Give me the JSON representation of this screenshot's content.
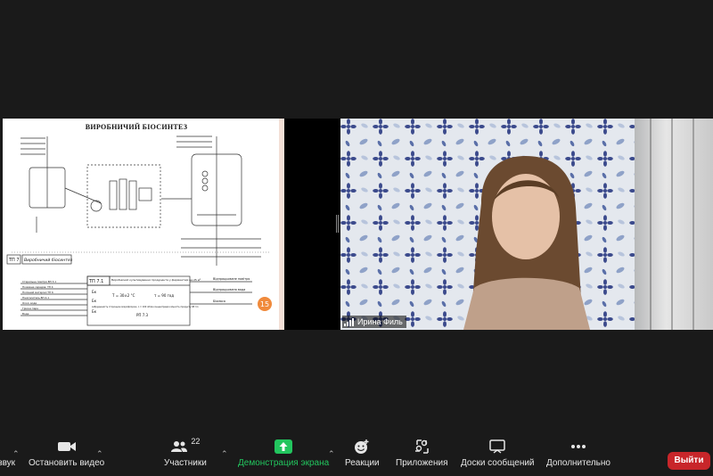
{
  "screen_share": {
    "doc_title": "ВИРОБНИЧИЙ БІОСИНТЕЗ",
    "slide_number": "15",
    "section_label": "Виробничий біосинтез",
    "code_main": "ТП 7",
    "code_sub": "ТП 7.1",
    "process_box": "Виробничий культивування продуцента у ферментері на 25 м³",
    "param_t": "T = 30±2 °С",
    "param_tau": "τ = 90 год",
    "param_extra": "забрудненість стороньою мікрофлорою, n = 100 об/хв концентрація кількість продукту 98 г/л",
    "param_ref": "РП 7.3",
    "output_1": "Відпрацьоване повітря",
    "output_2": "Відпрацьована вода",
    "output_3": "Біомаса",
    "inputs": [
      "Стерильне повітря ВП 3.1",
      "Поживне середов. ТП 4",
      "Посівний матеріал ТП 6",
      "Піногаситель ВП 4.1",
      "Охол. вода",
      "Гріюча пара",
      "Вода"
    ],
    "side_1": "Бк",
    "side_2": "Бк",
    "side_3": "Бк"
  },
  "participant": {
    "name": "Ирина Филь"
  },
  "toolbar": {
    "audio_label": "звук",
    "video_label": "Остановить видео",
    "participants_label": "Участники",
    "participants_count": "22",
    "share_label": "Демонстрация экрана",
    "reactions_label": "Реакции",
    "apps_label": "Приложения",
    "whiteboards_label": "Доски сообщений",
    "more_label": "Дополнительно",
    "leave_label": "Выйти"
  },
  "colors": {
    "share_accent": "#22c55e",
    "leave": "#c8262a",
    "slide_badge": "#f08a3c"
  }
}
